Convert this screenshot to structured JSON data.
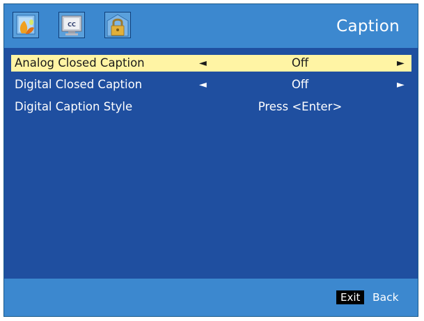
{
  "header": {
    "tabs": [
      {
        "name": "picture",
        "icon": "picture-settings-icon"
      },
      {
        "name": "caption",
        "icon": "cc-monitor-icon",
        "icon_text": "CC"
      },
      {
        "name": "lock",
        "icon": "padlock-icon"
      }
    ],
    "title": "Caption"
  },
  "menu": {
    "items": [
      {
        "label": "Analog Closed Caption",
        "value": "Off",
        "left_arrow": "◄",
        "right_arrow": "►",
        "selected": true
      },
      {
        "label": "Digital Closed Caption",
        "value": "Off",
        "left_arrow": "◄",
        "right_arrow": "►",
        "selected": false
      },
      {
        "label": "Digital Caption Style",
        "value": "Press <Enter>",
        "selected": false
      }
    ]
  },
  "footer": {
    "exit_label": "Exit",
    "back_label": "Back"
  },
  "colors": {
    "header_bg": "#3c88cf",
    "main_bg": "#1f4fa0",
    "highlight": "#fff4a4",
    "text": "#ffffff"
  }
}
